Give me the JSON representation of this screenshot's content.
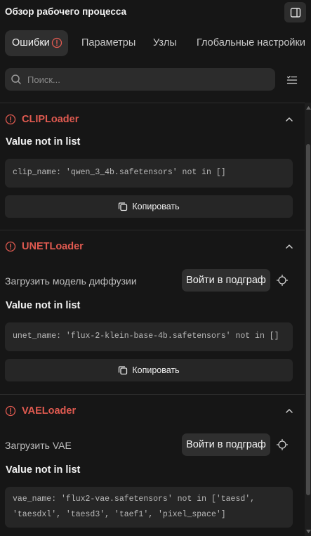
{
  "header": {
    "title": "Обзор рабочего процесса",
    "panel_icon": "sidebar-panel-icon"
  },
  "tabs": [
    {
      "label": "Ошибки",
      "active": true,
      "badge_icon": "error-circle-icon"
    },
    {
      "label": "Параметры",
      "active": false
    },
    {
      "label": "Узлы",
      "active": false
    },
    {
      "label": "Глобальные настройки",
      "active": false
    }
  ],
  "search": {
    "placeholder": "Поиск...",
    "value": ""
  },
  "sections": [
    {
      "node": "CLIPLoader",
      "error_title": "Value not in list",
      "message_lines": [
        "clip_name: 'qwen_3_4b.safetensors' not in []"
      ],
      "copy_label": "Копировать"
    },
    {
      "node": "UNETLoader",
      "node_label": "Загрузить модель диффузии",
      "enter_label": "Войти в подграф",
      "error_title": "Value not in list",
      "message_lines": [
        "unet_name: 'flux-2-klein-base-4b.safetensors' not in []"
      ],
      "copy_label": "Копировать"
    },
    {
      "node": "VAELoader",
      "node_label": "Загрузить VAE",
      "enter_label": "Войти в подграф",
      "error_title": "Value not in list",
      "message_lines": [
        "vae_name: 'flux2-vae.safetensors' not in ['taesd',",
        "'taesdxl', 'taesd3', 'taef1', 'pixel_space']"
      ]
    }
  ],
  "colors": {
    "error_accent": "#e05a50",
    "background": "#161616",
    "surface": "#262626"
  }
}
